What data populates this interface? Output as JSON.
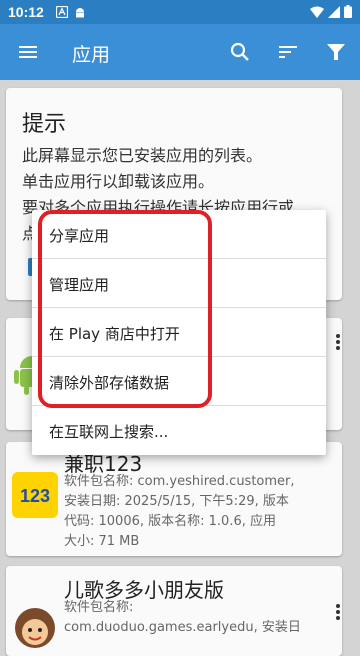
{
  "status_bar": {
    "time": "10:12"
  },
  "app_bar": {
    "title": "应用"
  },
  "tip": {
    "title": "提示",
    "lines": [
      "此屏幕显示您已安装应用的列表。",
      "单击应用行以卸载该应用。",
      "要对多个应用执行操作请长按应用行或",
      "点"
    ]
  },
  "apps": [
    {
      "name": "兼职123",
      "details": [
        "软件包名称: com.yeshired.customer,",
        "安装日期: 2025/5/15, 下午5:29, 版本",
        "代码: 10006, 版本名称: 1.0.6, 应用",
        "大小: 71 MB"
      ],
      "icon_text": "123"
    },
    {
      "name": "儿歌多多小朋友版",
      "details": [
        "软件包名称:",
        "com.duoduo.games.earlyedu, 安装日"
      ]
    }
  ],
  "context_menu": {
    "items": [
      "分享应用",
      "管理应用",
      "在 Play 商店中打开",
      "清除外部存储数据",
      "在互联网上搜索..."
    ]
  },
  "colors": {
    "status_bar": "#2c7ec2",
    "app_bar": "#3a8fd6",
    "highlight": "#e02027"
  }
}
